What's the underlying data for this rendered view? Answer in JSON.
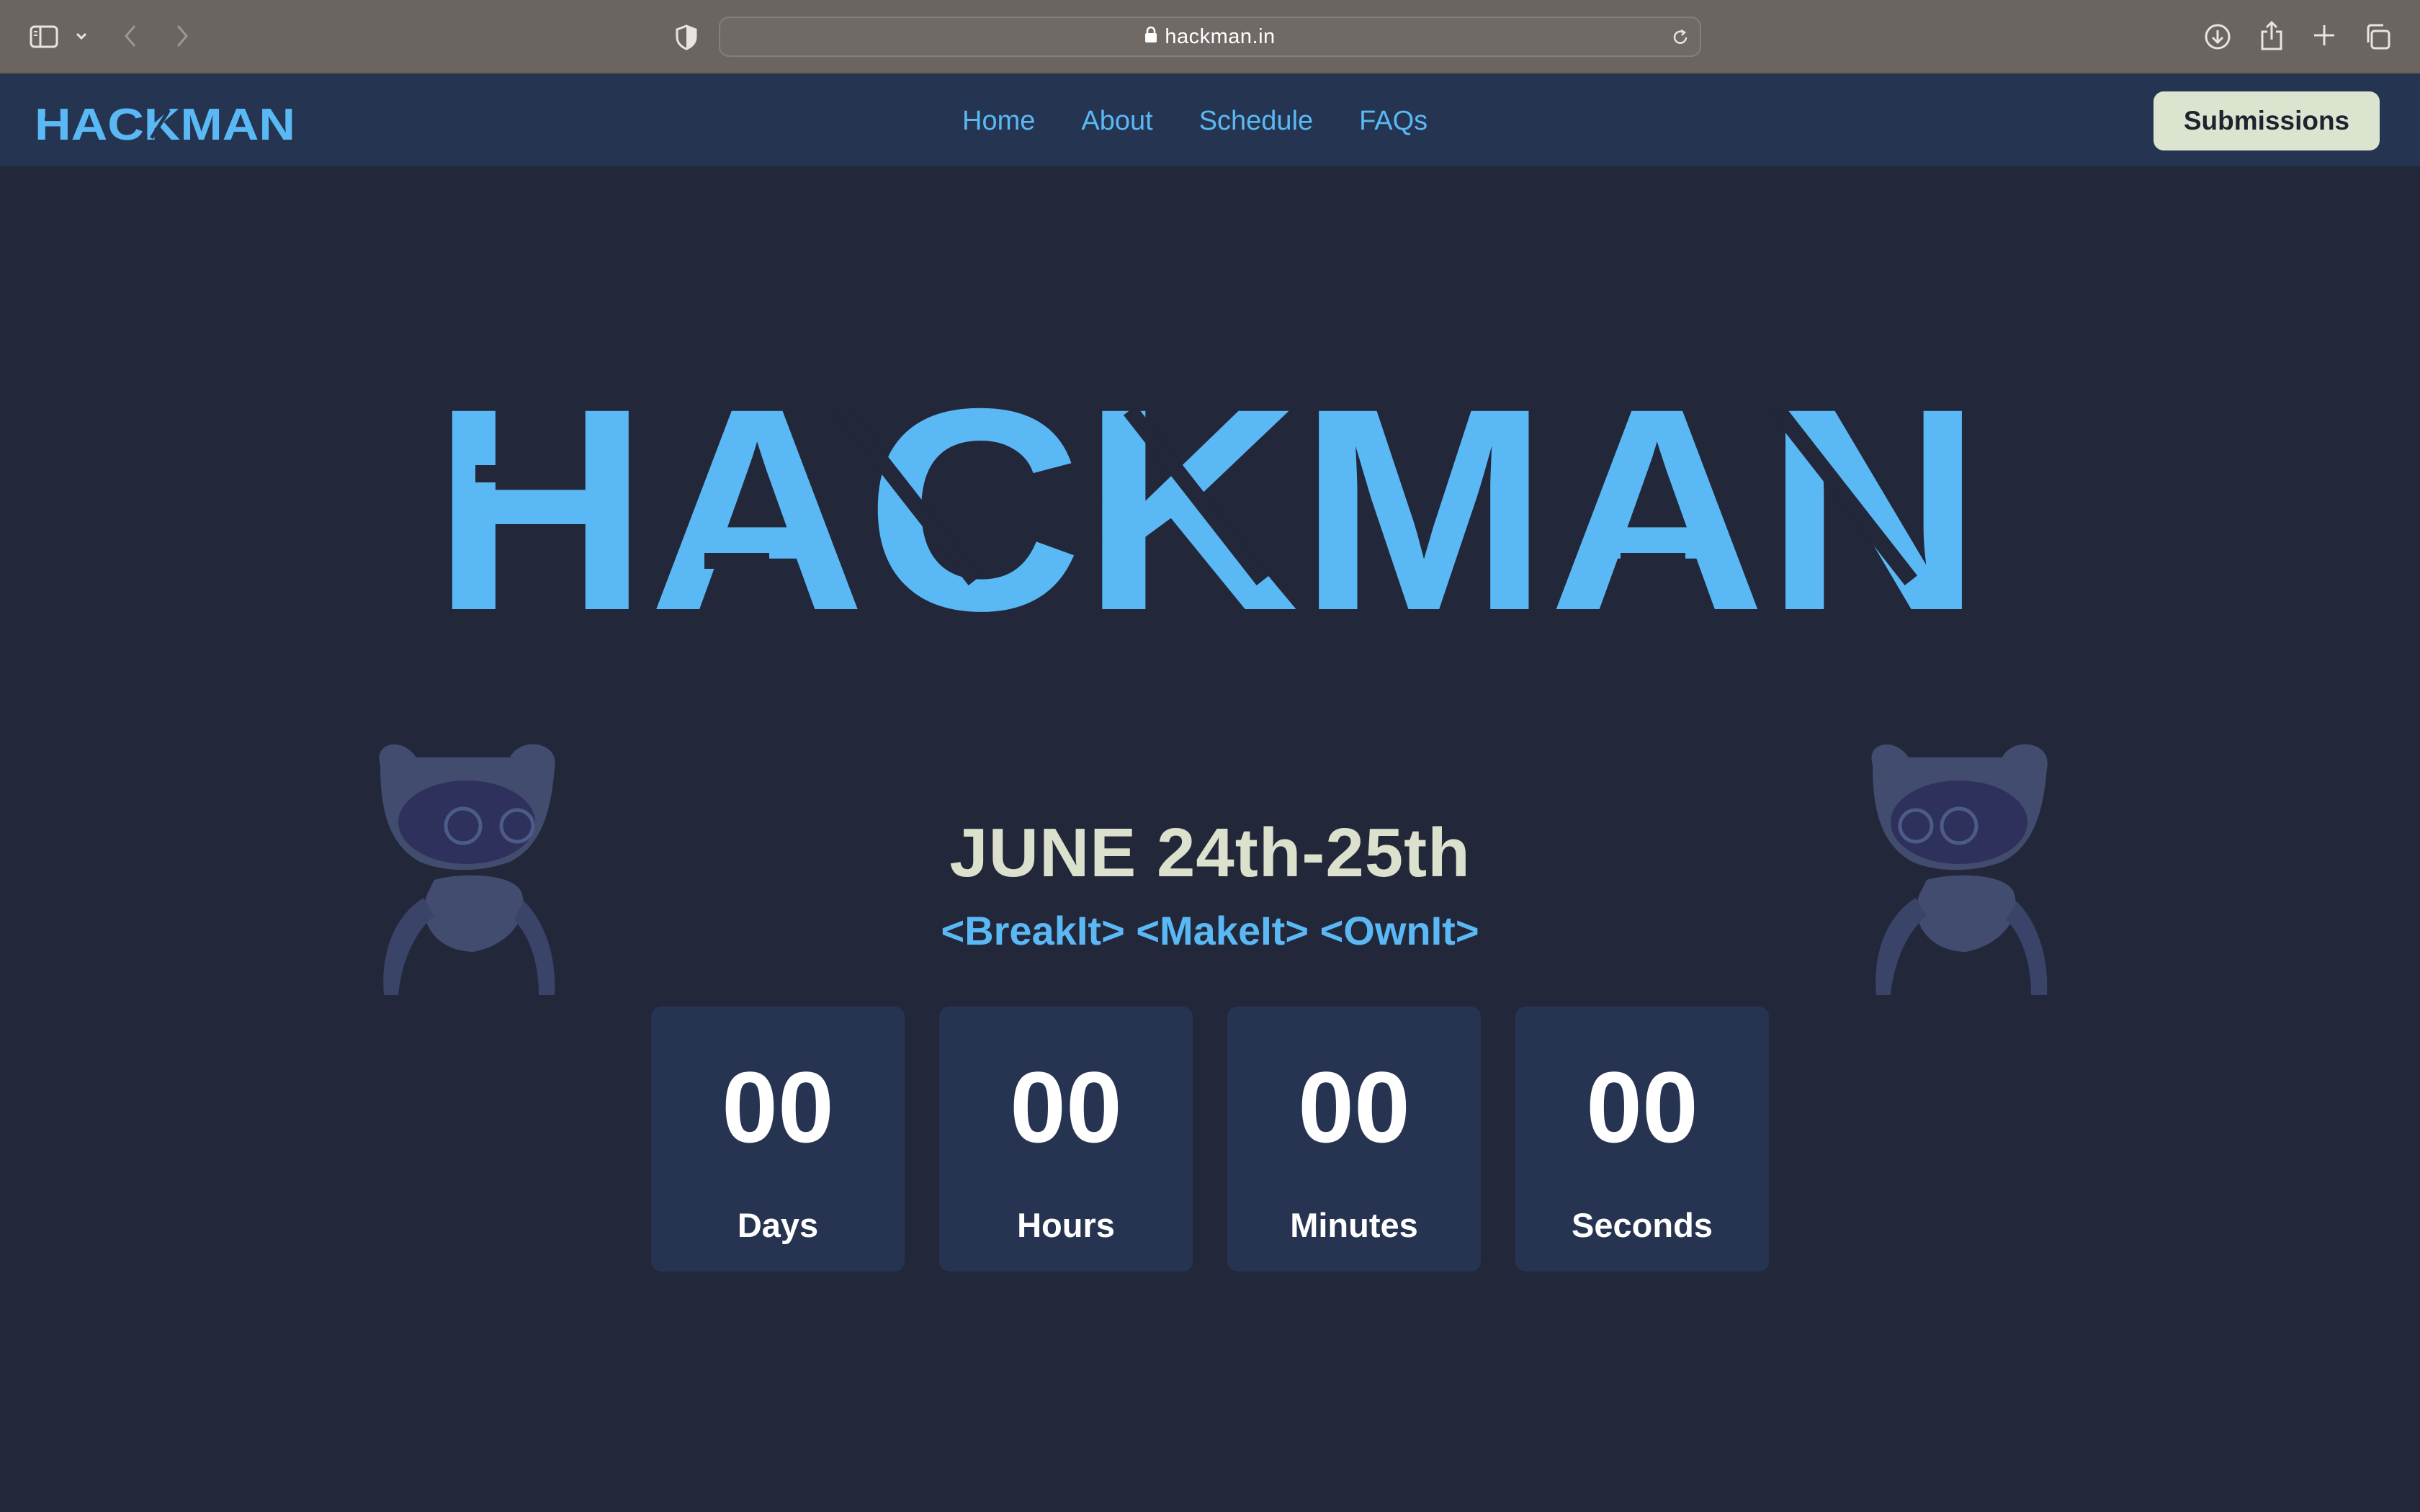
{
  "browser": {
    "url": "hackman.in"
  },
  "nav": {
    "logo_text": "HACKMAN",
    "links": [
      "Home",
      "About",
      "Schedule",
      "FAQs"
    ],
    "submissions_label": "Submissions"
  },
  "hero": {
    "logo_text": "HACKMAN",
    "date": "JUNE 24th-25th",
    "tagline": "<BreakIt> <MakeIt> <OwnIt>"
  },
  "countdown": [
    {
      "value": "00",
      "label": "Days"
    },
    {
      "value": "00",
      "label": "Hours"
    },
    {
      "value": "00",
      "label": "Minutes"
    },
    {
      "value": "00",
      "label": "Seconds"
    }
  ],
  "colors": {
    "page_bg": "#23273a",
    "nav_bg": "#253551",
    "accent_blue": "#5ab8f5",
    "date_text": "#dbe1cc",
    "button_bg": "#dbe4cf",
    "card_bg": "#263452"
  },
  "icons": [
    "sidebar-toggle-icon",
    "chevron-down-icon",
    "back-arrow-icon",
    "forward-arrow-icon",
    "privacy-shield-icon",
    "lock-icon",
    "reload-icon",
    "download-icon",
    "share-icon",
    "new-tab-icon",
    "tab-overview-icon",
    "robot-mascot-icon"
  ]
}
